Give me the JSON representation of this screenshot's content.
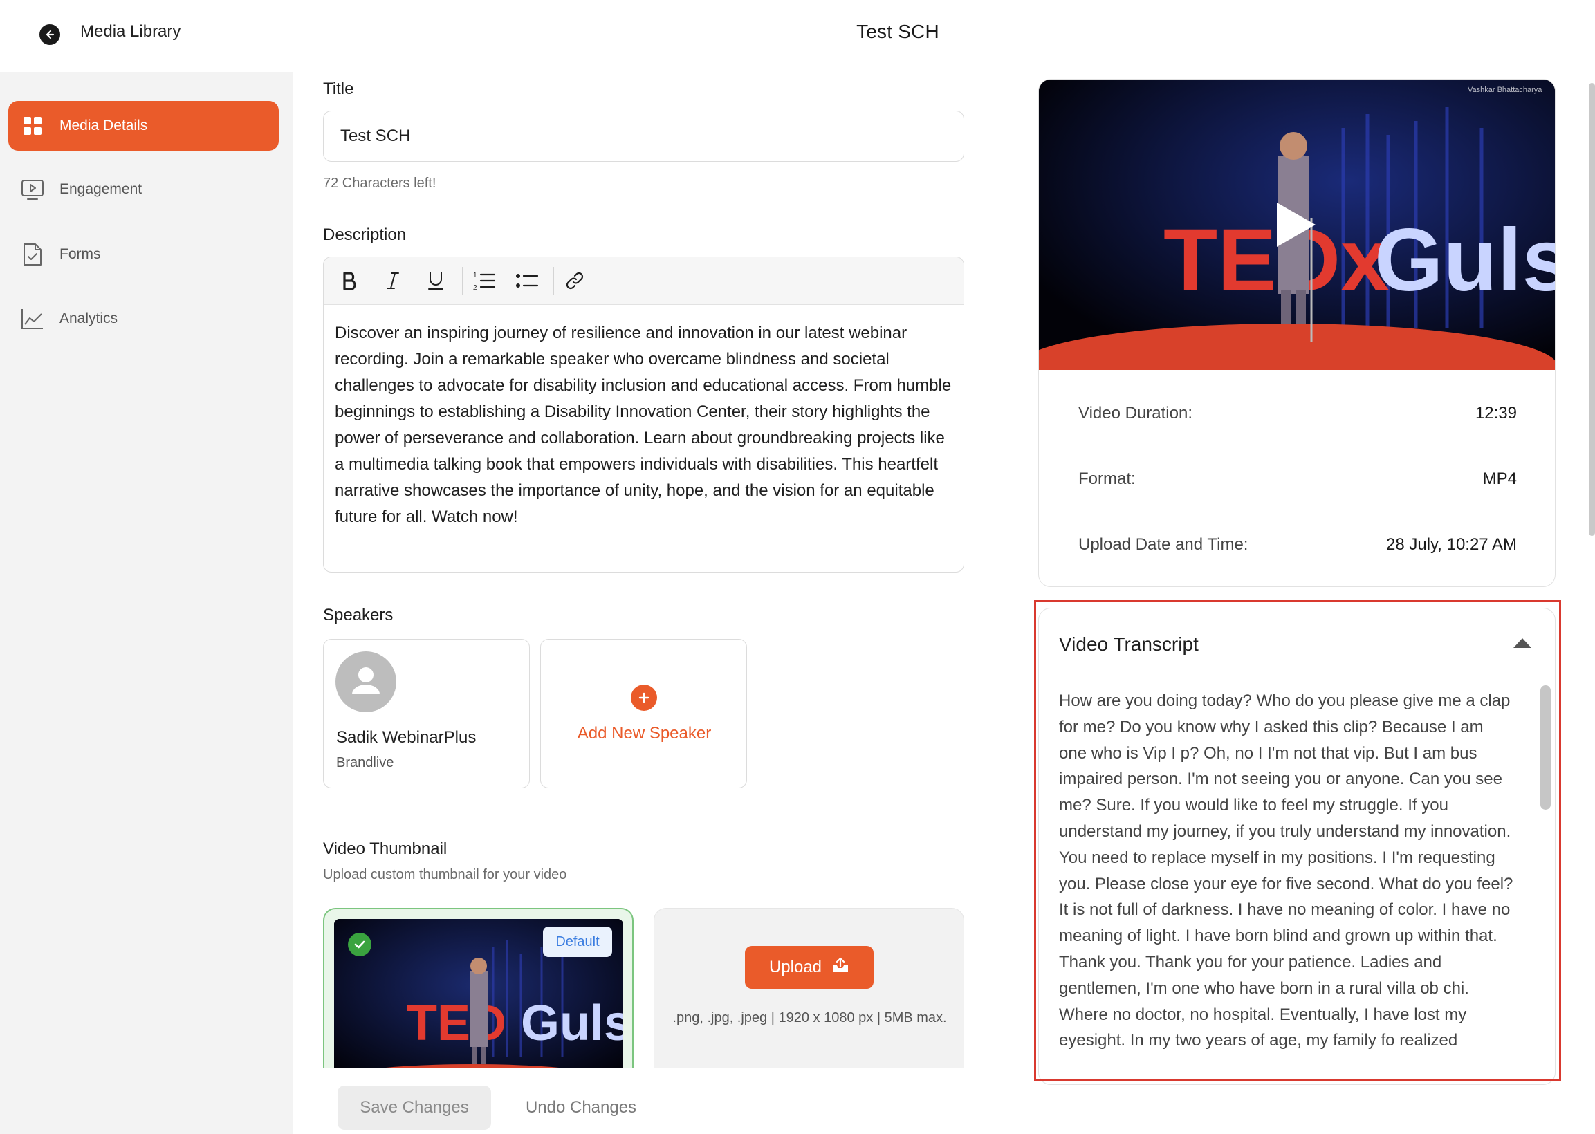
{
  "header": {
    "back_label": "Media Library",
    "title": "Test SCH"
  },
  "sidebar": {
    "items": [
      {
        "label": "Media Details",
        "icon": "grid-icon",
        "active": true
      },
      {
        "label": "Engagement",
        "icon": "play-screen-icon",
        "active": false
      },
      {
        "label": "Forms",
        "icon": "document-check-icon",
        "active": false
      },
      {
        "label": "Analytics",
        "icon": "line-chart-icon",
        "active": false
      }
    ]
  },
  "form": {
    "title_label": "Title",
    "title_value": "Test SCH",
    "title_counter": "72 Characters left!",
    "description_label": "Description",
    "toolbar": [
      "bold-icon",
      "italic-icon",
      "underline-icon",
      "ordered-list-icon",
      "bullet-list-icon",
      "link-icon"
    ],
    "description_text": "Discover an inspiring journey of resilience and innovation in our latest webinar recording. Join a remarkable speaker who overcame blindness and societal challenges to advocate for disability inclusion and educational access. From humble beginnings to establishing a Disability Innovation Center, their story highlights the power of perseverance and collaboration. Learn about groundbreaking projects like a multimedia talking book that empowers individuals with disabilities. This heartfelt narrative showcases the importance of unity, hope, and the vision for an equitable future for all. Watch now!",
    "speakers_label": "Speakers",
    "speaker": {
      "name": "Sadik WebinarPlus",
      "org": "Brandlive"
    },
    "add_speaker_label": "Add New Speaker",
    "thumbnail_label": "Video Thumbnail",
    "thumbnail_sub": "Upload custom thumbnail for your video",
    "default_badge": "Default",
    "upload_label": "Upload",
    "upload_hint": ".png, .jpg, .jpeg | 1920 x 1080 px | 5MB max."
  },
  "footer": {
    "save_label": "Save Changes",
    "undo_label": "Undo Changes"
  },
  "video": {
    "duration_label": "Video Duration:",
    "duration_value": "12:39",
    "format_label": "Format:",
    "format_value": "MP4",
    "upload_label": "Upload Date and Time:",
    "upload_value": "28 July, 10:27 AM"
  },
  "transcript": {
    "title": "Video Transcript",
    "text": "How are you doing today? Who do you please give me a clap for me? Do you know why I asked this clip? Because I am one who is Vip I p? Oh, no I I'm not that vip. But I am bus impaired person. I'm not seeing you or anyone. Can you see me? Sure. If you would like to feel my struggle. If you understand my journey, if you truly understand my innovation. You need to replace myself in my positions. I I'm requesting you. Please close your eye for five second. What do you feel? It is not full of darkness. I have no meaning of color. I have no meaning of light. I have born blind and grown up within that. Thank you. Thank you for your patience. Ladies and gentlemen, I'm one who have born in a rural villa ob chi. Where no doctor, no hospital. Eventually, I have lost my eyesight. In my two years of age, my family fo realized"
  },
  "colors": {
    "accent": "#ea5b2a",
    "highlight": "#d9392f",
    "success": "#3aa33f"
  }
}
